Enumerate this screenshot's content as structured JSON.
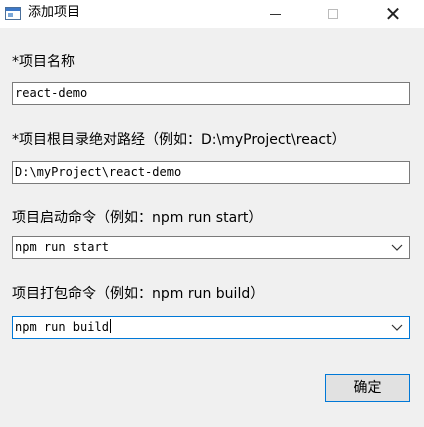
{
  "window": {
    "title": "添加项目",
    "icon": "app-window-icon",
    "controls": {
      "minimize_icon": "minimize-icon",
      "maximize_icon": "maximize-icon",
      "close_icon": "close-icon",
      "close_glyph": "✕"
    }
  },
  "form": {
    "name": {
      "label": "*项目名称",
      "value": "react-demo"
    },
    "path": {
      "label": "*项目根目录绝对路经（例如：D:\\myProject\\react）",
      "value": "D:\\myProject\\react-demo"
    },
    "start_cmd": {
      "label": "项目启动命令（例如：npm run start）",
      "value": "npm run start"
    },
    "build_cmd": {
      "label": "项目打包命令（例如：npm run build）",
      "value": "npm run build"
    }
  },
  "buttons": {
    "ok_label": "确定"
  },
  "colors": {
    "focus_border": "#0078d7",
    "background": "#f0f0f0",
    "field_border": "#7a7a7a"
  }
}
